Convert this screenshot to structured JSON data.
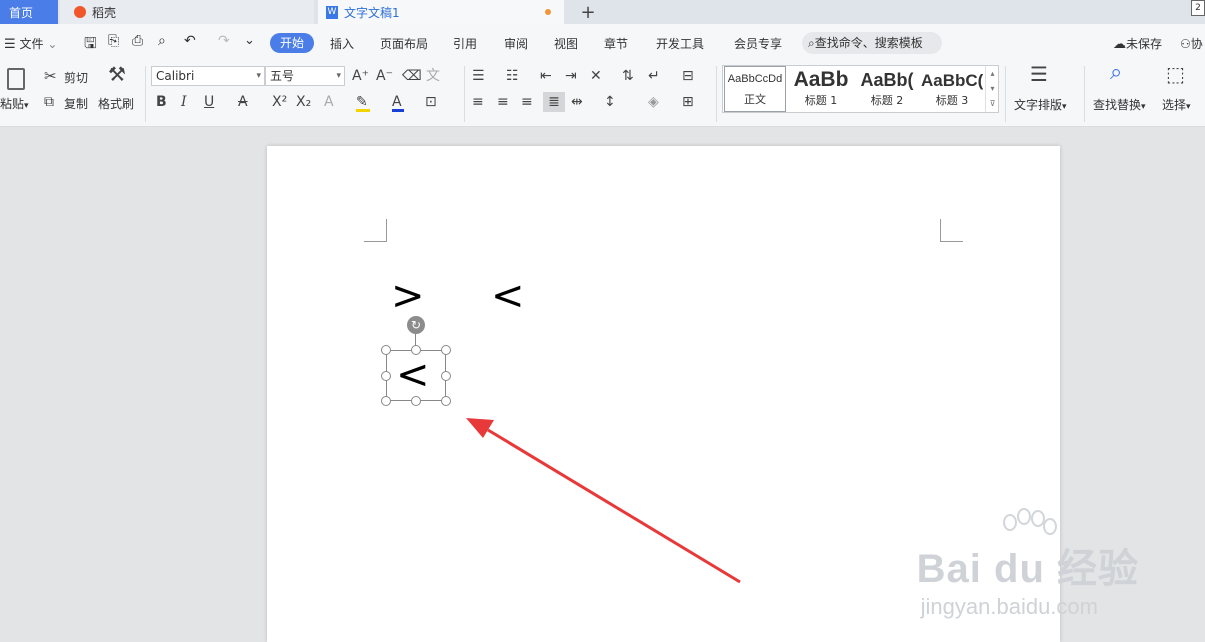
{
  "tabs": {
    "home": "首页",
    "daoke": "稻壳",
    "doc": "文字文稿1",
    "new": "+"
  },
  "menu": {
    "file": "文件",
    "start": "开始",
    "insert": "插入",
    "layout": "页面布局",
    "reference": "引用",
    "review": "审阅",
    "view": "视图",
    "chapter": "章节",
    "devtools": "开发工具",
    "member": "会员专享",
    "search_placeholder": "查找命令、搜索模板",
    "unsaved": "未保存",
    "collab": "协"
  },
  "ribbon": {
    "paste": "粘贴",
    "cut": "剪切",
    "copy": "复制",
    "format_painter": "格式刷",
    "font_name": "Calibri",
    "font_size": "五号",
    "text_layout": "文字排版",
    "find_replace": "查找替换",
    "select": "选择",
    "styles": [
      {
        "preview": "AaBbCcDd",
        "label": "正文"
      },
      {
        "preview": "AaBb",
        "label": "标题 1"
      },
      {
        "preview": "AaBb(",
        "label": "标题 2"
      },
      {
        "preview": "AaBbC(",
        "label": "标题 3"
      }
    ]
  },
  "document": {
    "sym_left": ">",
    "sym_right": "<",
    "selected_sym": "<"
  },
  "watermark": {
    "brand": "Bai du 经验",
    "url": "jingyan.baidu.com"
  },
  "colors": {
    "accent": "#4a7de8",
    "arrow": "#e8393a",
    "font_color": "#1a3fd6",
    "highlight": "#f3d400"
  }
}
